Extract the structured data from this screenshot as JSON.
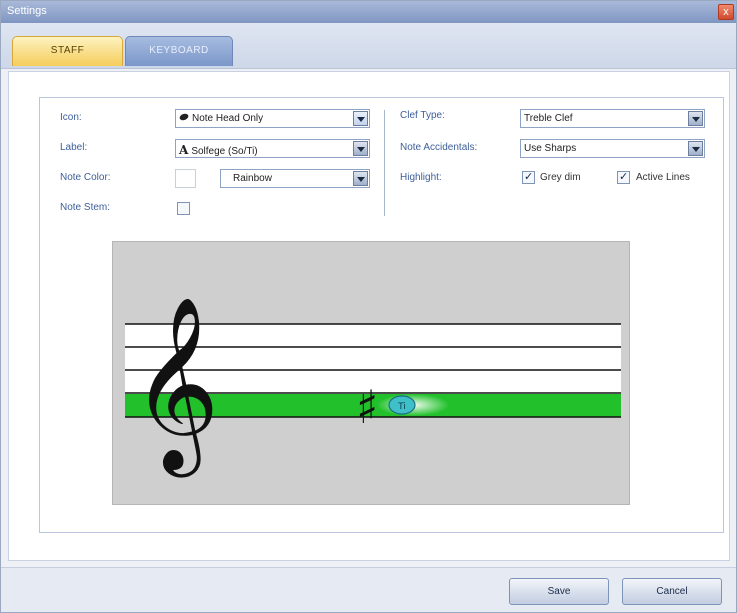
{
  "window": {
    "title": "Settings",
    "close_label": "x"
  },
  "tabs": [
    {
      "label": "STAFF",
      "active": true
    },
    {
      "label": "KEYBOARD",
      "active": false
    }
  ],
  "left": {
    "icon_label": "Icon:",
    "icon_value": "Note Head Only",
    "label_label": "Label:",
    "label_value": "Solfege (So/Ti)",
    "label_glyph": "A",
    "note_color_label": "Note Color:",
    "note_color_value": "Rainbow",
    "note_stem_label": "Note Stem:",
    "note_stem_checked": false
  },
  "right": {
    "clef_type_label": "Clef Type:",
    "clef_type_value": "Treble Clef",
    "accidentals_label": "Note Accidentals:",
    "accidentals_value": "Use Sharps",
    "highlight_label": "Highlight:",
    "grey_dim_label": "Grey dim",
    "grey_dim_checked": true,
    "active_lines_label": "Active Lines",
    "active_lines_checked": true
  },
  "preview": {
    "clef_glyph": "𝄞",
    "sharp_glyph": "♯",
    "note_label": "Ti",
    "highlight_color": "#22c12c",
    "note_color": "#3fc0c9"
  },
  "buttons": {
    "save": "Save",
    "cancel": "Cancel"
  },
  "colors": {
    "accent_tab": "#f5cd5a",
    "label_blue": "#3d5f9a"
  }
}
